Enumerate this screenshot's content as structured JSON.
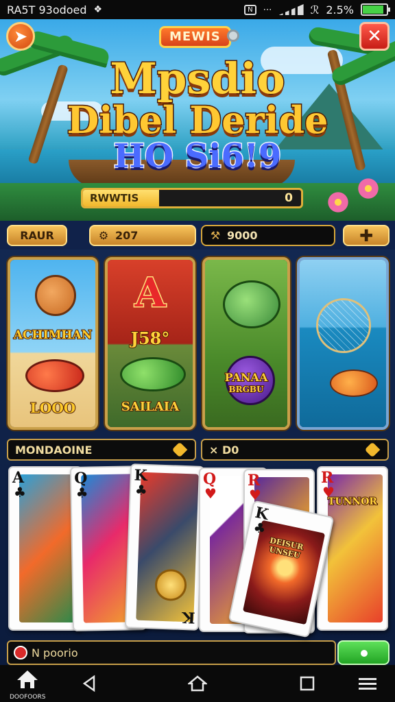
{
  "status_bar": {
    "left_text": "RA5T 93odoed",
    "battery_percent": "2.5%",
    "battery_level": 0.9,
    "icons": [
      "app-notification-icon",
      "nfc-icon",
      "wifi-icon",
      "signal-icon",
      "bluetooth-icon",
      "battery-icon"
    ]
  },
  "banner": {
    "badge": "MEWIS",
    "title_line1": "Mpsdio",
    "title_line2": "Dibel Deride",
    "title_line3": "HO Si6!9",
    "progress_label": "RWWTIS",
    "progress_value": "0",
    "progress_fraction": 0.35
  },
  "resources": {
    "left_button": "RAUR",
    "coins": "207",
    "gems": "9000",
    "add_icon": "plus-icon"
  },
  "game_cards": [
    {
      "label_top": "",
      "label_main": "ACHIMHAN",
      "label_sub": "LOOO"
    },
    {
      "label_top": "A",
      "label_main": "J58°",
      "label_sub": "SAILAIA"
    },
    {
      "label_top": "",
      "label_main": "PANAA",
      "label_sub": "BRGBU"
    },
    {
      "label_top": "",
      "label_main": "",
      "label_sub": ""
    }
  ],
  "sections": {
    "left": "MONDAOINE",
    "right": "× D0"
  },
  "playing_cards": [
    {
      "rank": "A",
      "suit": "♣",
      "color": "black"
    },
    {
      "rank": "Q",
      "suit": "♣",
      "color": "black"
    },
    {
      "rank": "K",
      "suit": "♣",
      "color": "black"
    },
    {
      "rank": "Q",
      "suit": "♥",
      "color": "red"
    },
    {
      "rank": "K",
      "suit": "♣",
      "color": "black"
    },
    {
      "rank": "R",
      "suit": "♥",
      "color": "red"
    },
    {
      "rank": "R",
      "suit": "♥",
      "color": "red"
    }
  ],
  "card_captions": {
    "center": "DEISUR\nUNSEU",
    "right": "TUNNOR"
  },
  "input_bar": {
    "text": "N poorio"
  },
  "nav": {
    "home_label": "DOOFOORS"
  },
  "colors": {
    "gold_border": "#c9a04a",
    "title_yellow": "#ffd23a",
    "title_blue": "#4a6bff",
    "close_red": "#e02a20"
  }
}
